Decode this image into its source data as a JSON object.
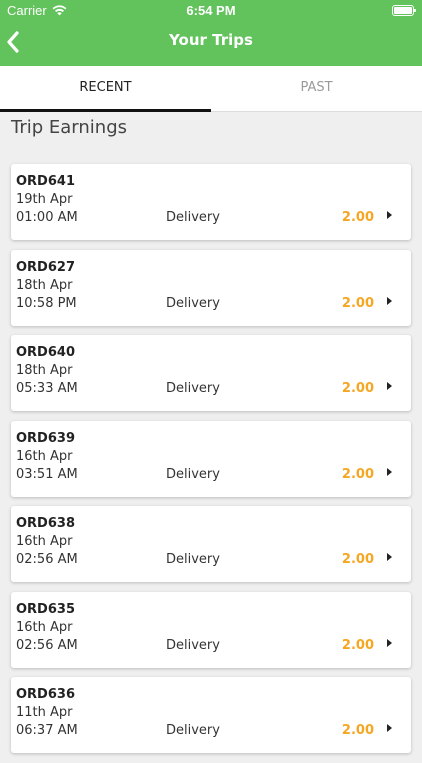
{
  "status_bar": {
    "carrier": "Carrier",
    "time": "6:54 PM",
    "wifi_icon": "wifi-icon",
    "battery_icon": "battery-icon"
  },
  "header": {
    "title": "Your Trips",
    "back_icon": "chevron-left-icon",
    "background_color": "#62c25c"
  },
  "tabs": [
    {
      "label": "RECENT",
      "active": true
    },
    {
      "label": "PAST",
      "active": false
    }
  ],
  "section_title": "Trip Earnings",
  "accent_color": "#f5a623",
  "trips": [
    {
      "id": "ORD641",
      "date": "19th Apr",
      "time": "01:00 AM",
      "type": "Delivery",
      "amount": "2.00"
    },
    {
      "id": "ORD627",
      "date": "18th Apr",
      "time": "10:58 PM",
      "type": "Delivery",
      "amount": "2.00"
    },
    {
      "id": "ORD640",
      "date": "18th Apr",
      "time": "05:33 AM",
      "type": "Delivery",
      "amount": "2.00"
    },
    {
      "id": "ORD639",
      "date": "16th Apr",
      "time": "03:51 AM",
      "type": "Delivery",
      "amount": "2.00"
    },
    {
      "id": "ORD638",
      "date": "16th Apr",
      "time": "02:56 AM",
      "type": "Delivery",
      "amount": "2.00"
    },
    {
      "id": "ORD635",
      "date": "16th Apr",
      "time": "02:56 AM",
      "type": "Delivery",
      "amount": "2.00"
    },
    {
      "id": "ORD636",
      "date": "11th Apr",
      "time": "06:37 AM",
      "type": "Delivery",
      "amount": "2.00"
    }
  ]
}
